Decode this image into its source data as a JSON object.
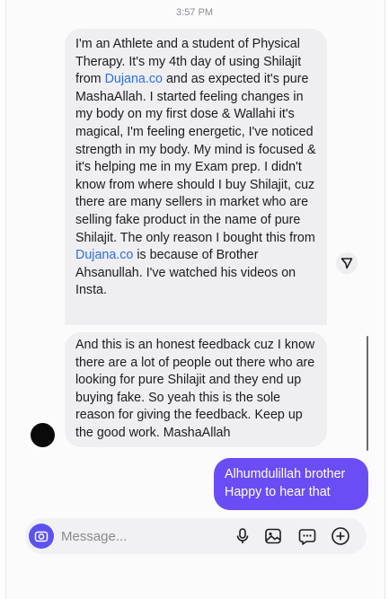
{
  "status": {
    "time": "3:57 PM"
  },
  "messages": {
    "first": {
      "part1": "I'm an Athlete and a student of Physical Therapy. It's my 4th day of using Shilajit from ",
      "link1": "Dujana.co",
      "part2": " and as expected it's pure MashaAllah. I started feeling changes in my body on my first dose & Wallahi it's magical, I'm feeling energetic, I've noticed strength in my body. My mind is focused & it's helping me in my Exam prep. I didn't know from where should I buy Shilajit, cuz there are many sellers in market who are selling fake product in the name of pure Shilajit. The only reason I bought this from ",
      "link2": "Dujana.co",
      "part3": " is because of Brother Ahsanullah. I've watched his videos on Insta."
    },
    "second": "And this is an honest feedback cuz I know there are a lot of people out there who are looking for pure Shilajit and they end up buying fake. So yeah this is the sole reason for giving the feedback. Keep up the good work. MashaAllah",
    "reply": "Alhumdulillah brother Happy to hear that"
  },
  "composer": {
    "placeholder": "Message...",
    "icons": [
      "camera-icon",
      "microphone-icon",
      "image-icon",
      "sticker-icon",
      "plus-icon"
    ]
  },
  "colors": {
    "accent": "#6b4df5",
    "camera": "#5c52f0",
    "incoming_bubble": "#efeff2",
    "link": "#2f6fde"
  }
}
